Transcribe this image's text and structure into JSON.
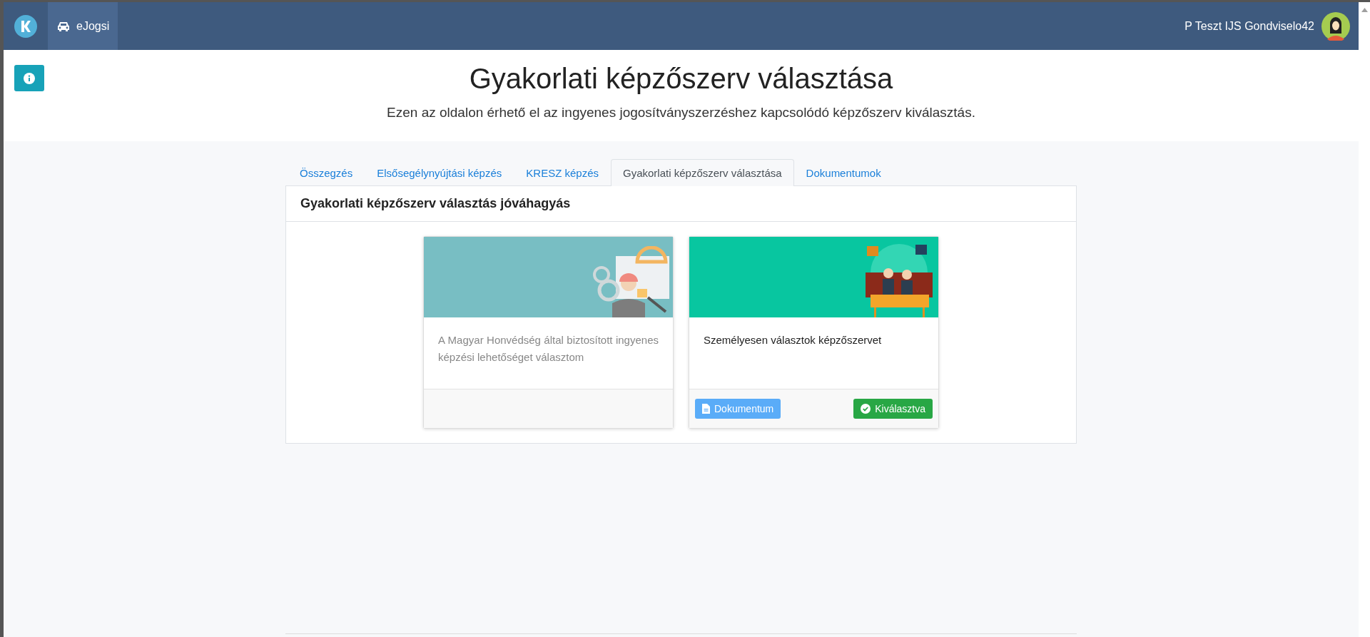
{
  "topbar": {
    "app_name": "eJogsi",
    "user_name": "P Teszt IJS Gondviselo42"
  },
  "header": {
    "title": "Gyakorlati képzőszerv választása",
    "subtitle": "Ezen az oldalon érhető el az ingyenes jogosítványszerzéshez kapcsolódó képzőszerv kiválasztás."
  },
  "tabs": [
    {
      "label": "Összegzés",
      "selected": false
    },
    {
      "label": "Elsősegélynyújtási képzés",
      "selected": false
    },
    {
      "label": "KRESZ képzés",
      "selected": false
    },
    {
      "label": "Gyakorlati képzőszerv választása",
      "selected": true
    },
    {
      "label": "Dokumentumok",
      "selected": false
    }
  ],
  "panel": {
    "title": "Gyakorlati képzőszerv választás jóváhagyás",
    "options": [
      {
        "kind": "military",
        "text": "A Magyar Honvédség által biztosított ingyenes képzési lehetőséget választom",
        "selected": false
      },
      {
        "kind": "personal",
        "text": "Személyesen választok képzőszervet",
        "selected": true,
        "actions": [
          {
            "kind": "document",
            "label": "Dokumentum"
          },
          {
            "kind": "chosen",
            "label": "Kiválasztva"
          }
        ]
      }
    ]
  }
}
